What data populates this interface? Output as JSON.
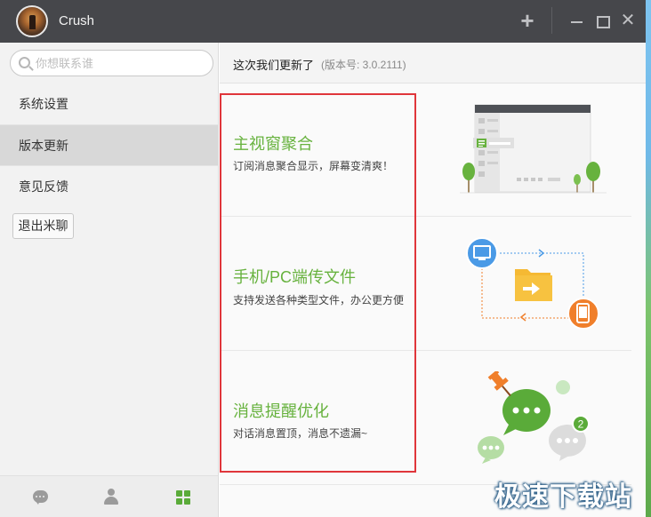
{
  "window": {
    "title": "Crush"
  },
  "search": {
    "placeholder": "你想联系谁"
  },
  "sidebar": {
    "items": [
      {
        "label": "系统设置"
      },
      {
        "label": "版本更新",
        "active": true
      },
      {
        "label": "意见反馈"
      }
    ],
    "logout_label": "退出米聊"
  },
  "update": {
    "title": "这次我们更新了",
    "version": "(版本号: 3.0.2111)",
    "features": [
      {
        "title": "主视窗聚合",
        "desc": "订阅消息聚合显示，屏幕变清爽！",
        "icon": "window-aggregate-illustration"
      },
      {
        "title": "手机/PC端传文件",
        "desc": "支持发送各种类型文件，办公更方便",
        "icon": "file-transfer-illustration"
      },
      {
        "title": "消息提醒优化",
        "desc": "对话消息置顶，消息不遗漏~",
        "icon": "message-reminder-illustration"
      }
    ]
  },
  "bottom_nav": [
    "chat-icon",
    "contacts-icon",
    "apps-icon"
  ],
  "badge": {
    "count": "2"
  },
  "watermark": "极速下载站",
  "colors": {
    "titlebar": "#46474b",
    "accent_green": "#67b23e",
    "highlight_red": "#e0363b",
    "orange": "#f07f2b",
    "blue": "#4a9ae6"
  }
}
